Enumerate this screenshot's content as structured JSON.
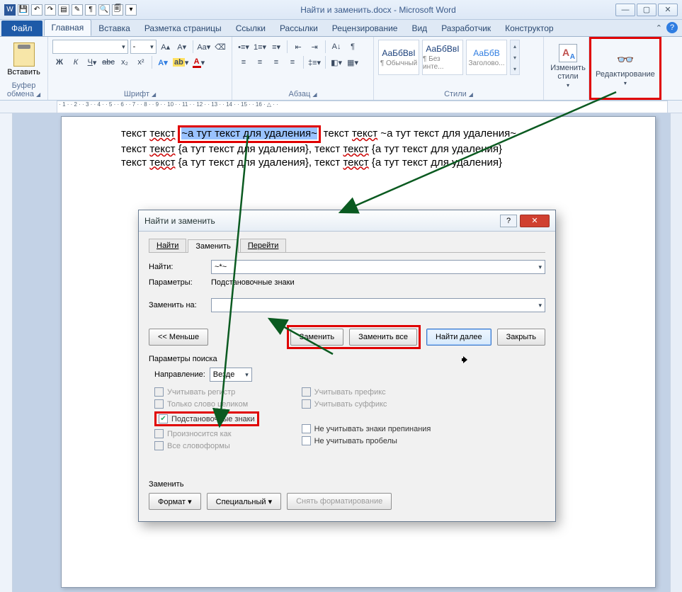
{
  "titlebar": {
    "title": "Найти и заменить.docx - Microsoft Word"
  },
  "win": {
    "min": "―",
    "max": "▢",
    "close": "✕"
  },
  "tabs": {
    "file": "Файл",
    "home": "Главная",
    "insert": "Вставка",
    "layout": "Разметка страницы",
    "refs": "Ссылки",
    "mail": "Рассылки",
    "review": "Рецензирование",
    "view": "Вид",
    "dev": "Разработчик",
    "design": "Конструктор"
  },
  "ribbon": {
    "paste": "Вставить",
    "clipboard_label": "Буфер обмена",
    "font_label": "Шрифт",
    "para_label": "Абзац",
    "styles_label": "Стили",
    "change_styles": "Изменить стили",
    "edit_label": "Редактирование",
    "font_size": "-",
    "styles": [
      {
        "sample": "АаБбВвІ",
        "name": "¶ Обычный"
      },
      {
        "sample": "АаБбВвІ",
        "name": "¶ Без инте..."
      },
      {
        "sample": "АаБбВ",
        "name": "Заголово..."
      }
    ]
  },
  "doc": {
    "line1_a": "текст ",
    "line1_b": "текст",
    "line1_hl": "~а тут текст для удаления~",
    "line1_c": " текст ",
    "line1_d": "текст",
    "line1_e": " ~а тут текст для удаления~",
    "line2_a": "текст ",
    "line2_b": "текст",
    "line2_c": " {а тут текст для удаления}, текст ",
    "line2_d": "текст",
    "line2_e": " {а тут текст для удаления}",
    "line3_a": "текст ",
    "line3_b": "текст",
    "line3_c": " {а тут текст для удаления}, текст ",
    "line3_d": "текст",
    "line3_e": " {а тут текст для удаления}"
  },
  "dialog": {
    "title": "Найти и заменить",
    "tab_find": "Найти",
    "tab_replace": "Заменить",
    "tab_goto": "Перейти",
    "find_label": "Найти:",
    "find_value": "~*~",
    "params_label": "Параметры:",
    "params_value": "Подстановочные знаки",
    "replace_label": "Заменить на:",
    "replace_value": "",
    "btn_less": "<< Меньше",
    "btn_replace": "Заменить",
    "btn_replace_all": "Заменить все",
    "btn_find_next": "Найти далее",
    "btn_close": "Закрыть",
    "search_params": "Параметры поиска",
    "direction_label": "Направление:",
    "direction_value": "Везде",
    "chk_case": "Учитывать регистр",
    "chk_whole": "Только слово целиком",
    "chk_wild": "Подстановочные знаки",
    "chk_sounds": "Произносится как",
    "chk_forms": "Все словоформы",
    "chk_prefix": "Учитывать префикс",
    "chk_suffix": "Учитывать суффикс",
    "chk_punct": "Не учитывать знаки препинания",
    "chk_space": "Не учитывать пробелы",
    "section_replace": "Заменить",
    "btn_format": "Формат ▾",
    "btn_special": "Специальный ▾",
    "btn_noformat": "Снять форматирование"
  }
}
